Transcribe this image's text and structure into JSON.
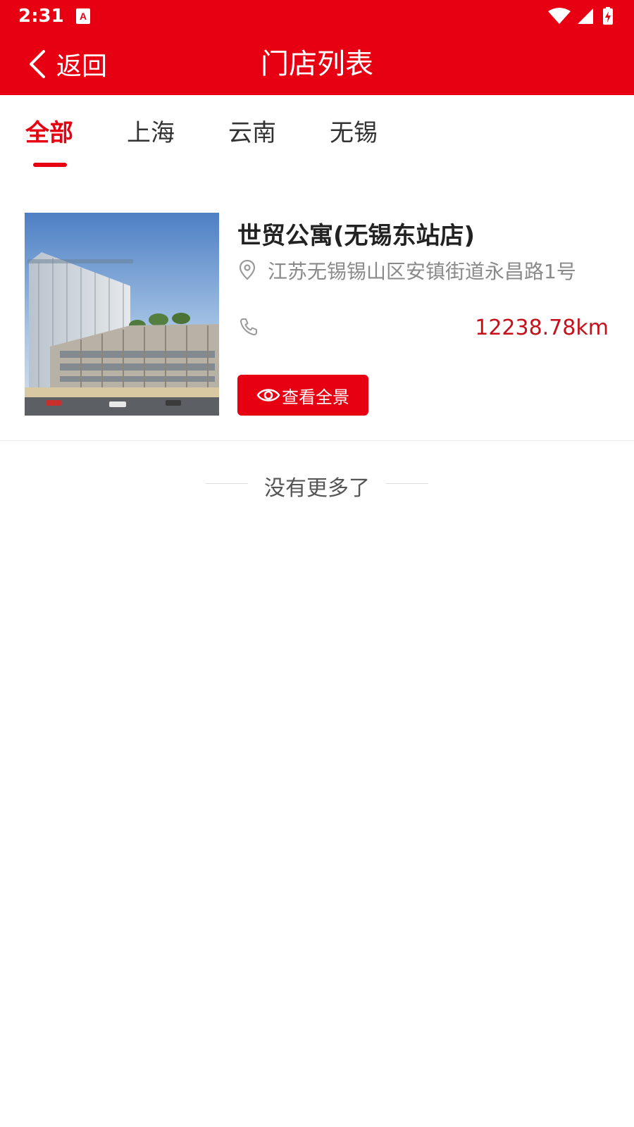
{
  "status_bar": {
    "time": "2:31",
    "app_badge_letter": "A"
  },
  "header": {
    "back_label": "返回",
    "title": "门店列表",
    "background": "#e60012"
  },
  "tabs": [
    {
      "label": "全部",
      "active": true
    },
    {
      "label": "上海",
      "active": false
    },
    {
      "label": "云南",
      "active": false
    },
    {
      "label": "无锡",
      "active": false
    }
  ],
  "stores": [
    {
      "name": "世贸公寓(无锡东站店)",
      "address": "江苏无锡锡山区安镇街道永昌路1号",
      "distance": "12238.78km",
      "pano_button_label": "查看全景"
    }
  ],
  "footer": {
    "no_more_text": "没有更多了"
  },
  "colors": {
    "accent": "#e60012",
    "distance": "#c4111b",
    "muted": "#8a8a8a"
  }
}
